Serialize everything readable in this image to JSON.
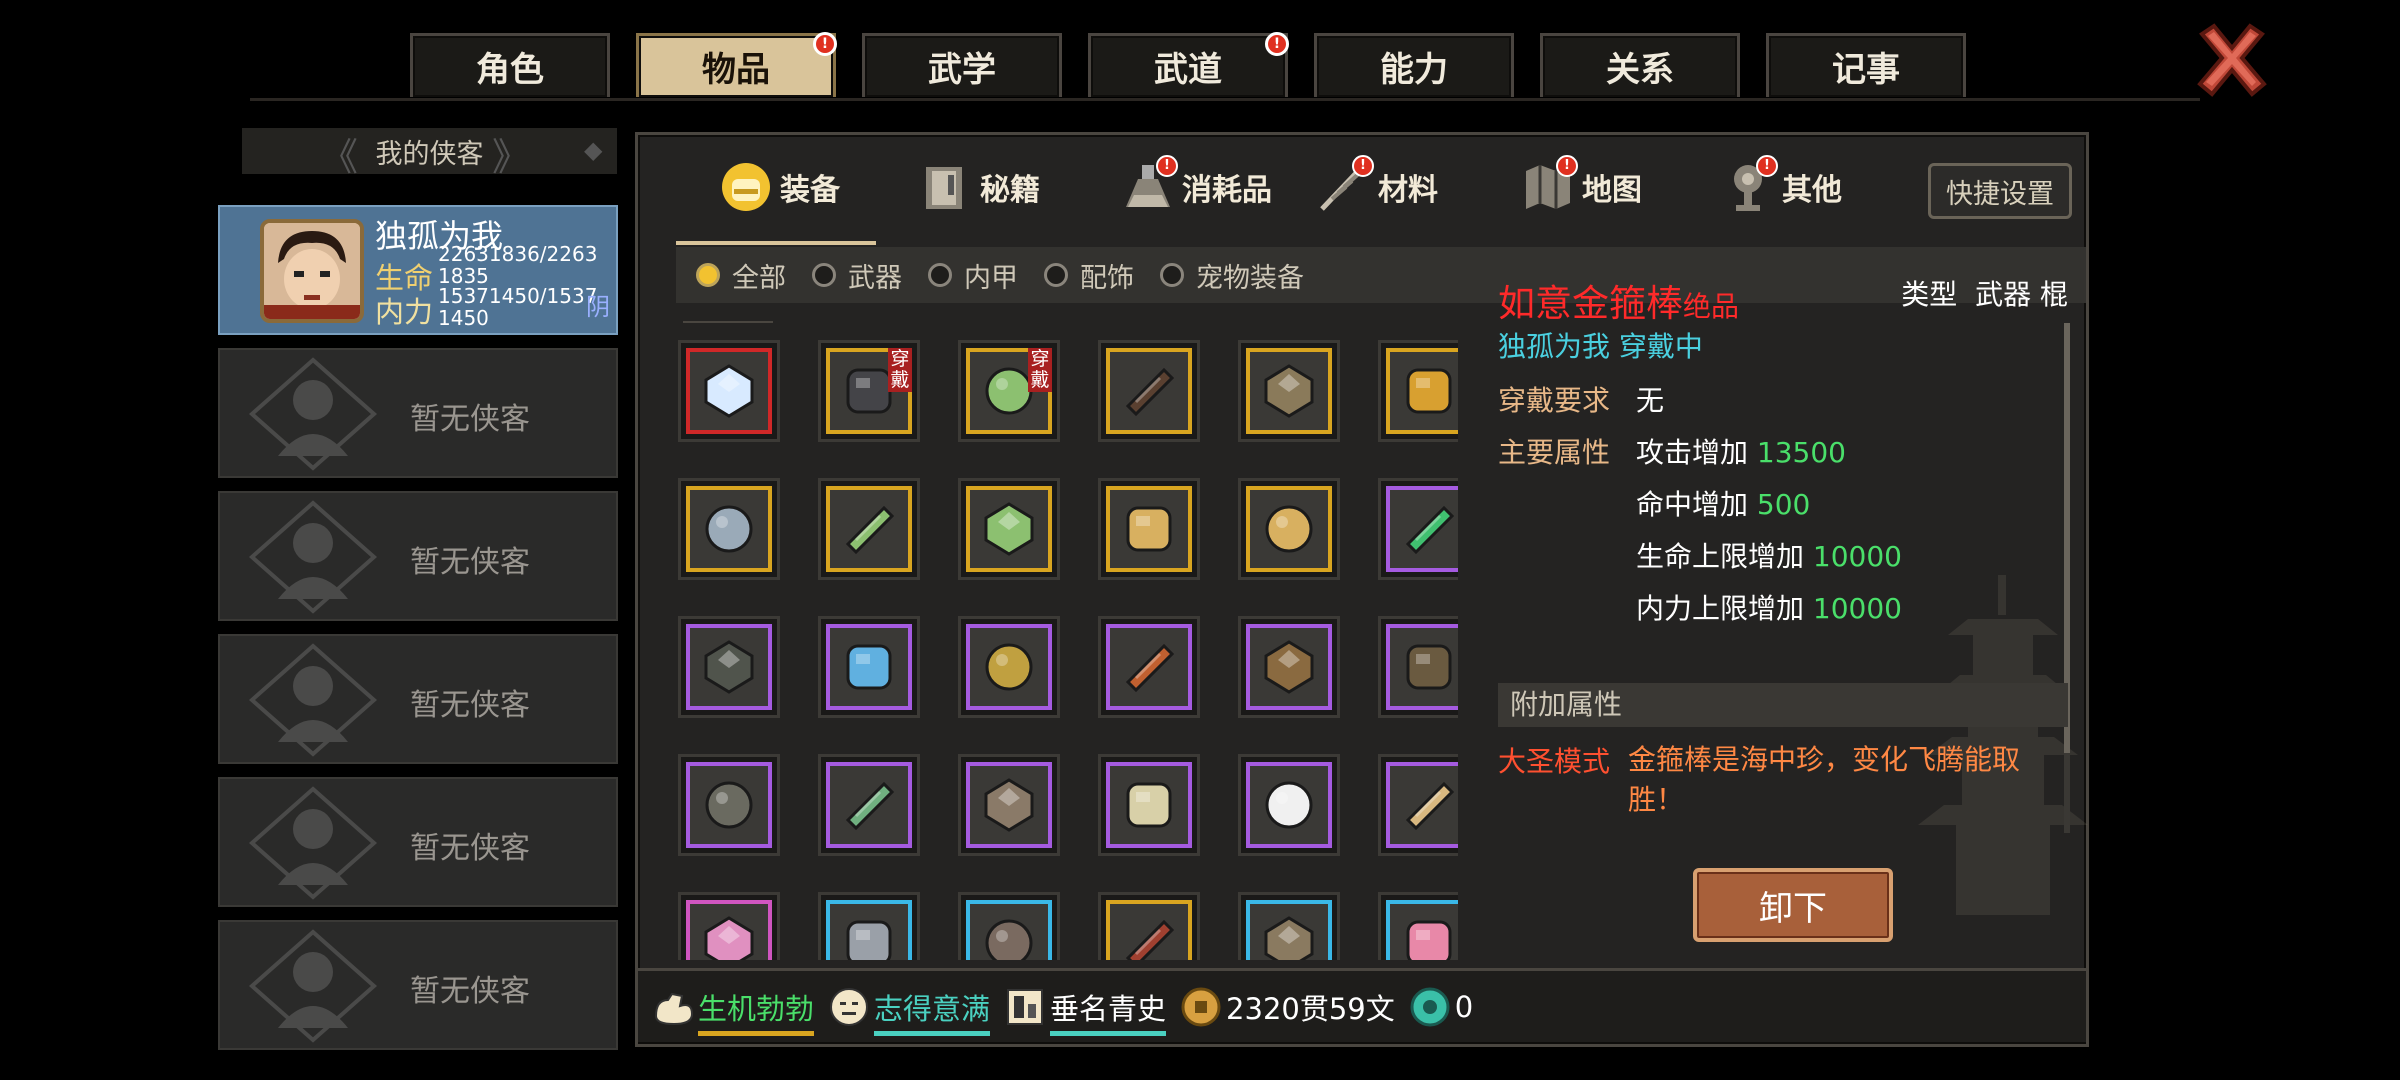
{
  "top_tabs": [
    {
      "label": "角色",
      "active": false,
      "badge": false
    },
    {
      "label": "物品",
      "active": true,
      "badge": true
    },
    {
      "label": "武学",
      "active": false,
      "badge": false
    },
    {
      "label": "武道",
      "active": false,
      "badge": true
    },
    {
      "label": "能力",
      "active": false,
      "badge": false
    },
    {
      "label": "关系",
      "active": false,
      "badge": false
    },
    {
      "label": "记事",
      "active": false,
      "badge": false
    }
  ],
  "badge_glyph": "!",
  "sidebar": {
    "title": "我的侠客",
    "hero": {
      "name": "独孤为我",
      "hp_label": "生命",
      "hp_value": "22631836/22631835",
      "mp_label": "内力",
      "mp_value": "15371450/15371450",
      "tag": "阴"
    },
    "empty_label": "暂无侠客",
    "empty_count": 5
  },
  "categories": [
    {
      "label": "装备",
      "icon": "helmet-icon",
      "badge": false,
      "active": true
    },
    {
      "label": "秘籍",
      "icon": "book-icon",
      "badge": false,
      "active": false
    },
    {
      "label": "消耗品",
      "icon": "flask-icon",
      "badge": true,
      "active": false
    },
    {
      "label": "材料",
      "icon": "herb-icon",
      "badge": true,
      "active": false
    },
    {
      "label": "地图",
      "icon": "map-icon",
      "badge": true,
      "active": false
    },
    {
      "label": "其他",
      "icon": "lamp-icon",
      "badge": true,
      "active": false
    }
  ],
  "quick_settings": "快捷设置",
  "filters": [
    {
      "label": "全部",
      "selected": true
    },
    {
      "label": "武器",
      "selected": false
    },
    {
      "label": "内甲",
      "selected": false
    },
    {
      "label": "配饰",
      "selected": false
    },
    {
      "label": "宠物装备",
      "selected": false
    }
  ],
  "worn_tag": "穿戴",
  "items": [
    {
      "name": "crystal-ball-icon",
      "rarity": "red",
      "color": "#d8eaff",
      "worn": false
    },
    {
      "name": "dark-armor-icon",
      "rarity": "gold",
      "color": "#444448",
      "worn": true
    },
    {
      "name": "jade-vest-icon",
      "rarity": "gold",
      "color": "#8cc070",
      "worn": true
    },
    {
      "name": "prayer-beads-icon",
      "rarity": "gold",
      "color": "#5a4030",
      "worn": false
    },
    {
      "name": "bamboo-scroll-icon",
      "rarity": "gold",
      "color": "#8a7a5a",
      "worn": false
    },
    {
      "name": "bronze-mask-icon",
      "rarity": "gold",
      "color": "#d8a030",
      "worn": false
    },
    {
      "name": "silver-bracer-icon",
      "rarity": "gold",
      "color": "#9aaab8",
      "worn": false
    },
    {
      "name": "jade-vest-icon",
      "rarity": "gold",
      "color": "#8cc070",
      "worn": false
    },
    {
      "name": "jade-vest-icon",
      "rarity": "gold",
      "color": "#8cc070",
      "worn": false
    },
    {
      "name": "gold-card-icon",
      "rarity": "gold",
      "color": "#d8b060",
      "worn": false
    },
    {
      "name": "gold-card-icon",
      "rarity": "gold",
      "color": "#d8b060",
      "worn": false
    },
    {
      "name": "jade-blade-icon",
      "rarity": "purple",
      "color": "#40c070",
      "worn": false
    },
    {
      "name": "iron-plate-icon",
      "rarity": "purple",
      "color": "#50544c",
      "worn": false
    },
    {
      "name": "blue-ribbon-icon",
      "rarity": "purple",
      "color": "#60b0e0",
      "worn": false
    },
    {
      "name": "gold-beast-icon",
      "rarity": "purple",
      "color": "#c0a040",
      "worn": false
    },
    {
      "name": "red-token-icon",
      "rarity": "purple",
      "color": "#c06030",
      "worn": false
    },
    {
      "name": "bronze-seal-icon",
      "rarity": "purple",
      "color": "#8a6a40",
      "worn": false
    },
    {
      "name": "clay-jar-icon",
      "rarity": "purple",
      "color": "#6a5a40",
      "worn": false
    },
    {
      "name": "stone-bar-icon",
      "rarity": "purple",
      "color": "#6a6a60",
      "worn": false
    },
    {
      "name": "jade-stone-icon",
      "rarity": "purple",
      "color": "#70b080",
      "worn": false
    },
    {
      "name": "ore-pendant-icon",
      "rarity": "purple",
      "color": "#8a7a68",
      "worn": false
    },
    {
      "name": "stone-seal-icon",
      "rarity": "purple",
      "color": "#d8d0a8",
      "worn": false
    },
    {
      "name": "white-feather-icon",
      "rarity": "purple",
      "color": "#f0f0f0",
      "worn": false
    },
    {
      "name": "beast-tooth-icon",
      "rarity": "purple",
      "color": "#d8b880",
      "worn": false
    },
    {
      "name": "pink-pouch-icon",
      "rarity": "pink",
      "color": "#e090c0",
      "worn": false
    },
    {
      "name": "steel-gauntlet-icon",
      "rarity": "blue",
      "color": "#9aa0a8",
      "worn": false
    },
    {
      "name": "sword-icon",
      "rarity": "blue",
      "color": "#7a6a60",
      "worn": false
    },
    {
      "name": "red-robe-icon",
      "rarity": "gold",
      "color": "#a04030",
      "worn": false
    },
    {
      "name": "wrapped-bundle-icon",
      "rarity": "blue",
      "color": "#8a7a60",
      "worn": false
    },
    {
      "name": "pink-flower-icon",
      "rarity": "blue",
      "color": "#e888a8",
      "worn": false
    }
  ],
  "detail": {
    "name": "如意金箍棒",
    "grade": "绝品",
    "type_label": "类型",
    "type_value": "武器 棍",
    "owner_line": "独孤为我 穿戴中",
    "req_label": "穿戴要求",
    "req_value": "无",
    "main_label": "主要属性",
    "attributes": [
      {
        "label": "攻击增加",
        "value": "13500"
      },
      {
        "label": "命中增加",
        "value": "500"
      },
      {
        "label": "生命上限增加",
        "value": "10000"
      },
      {
        "label": "内力上限增加",
        "value": "10000"
      }
    ],
    "extra_header": "附加属性",
    "extra_name": "大圣模式",
    "extra_desc": "金箍棒是海中珍，变化飞腾能取胜！",
    "unequip": "卸下"
  },
  "status": [
    {
      "icon": "muscle-icon",
      "text": "生机勃勃",
      "color": "#4adf6a",
      "bar": "#d9a520"
    },
    {
      "icon": "smile-icon",
      "text": "志得意满",
      "color": "#4ad0c0",
      "bar": "#4ad0c0"
    },
    {
      "icon": "scroll-icon",
      "text": "垂名青史",
      "color": "#ffffff",
      "bar": "#4ad0c0"
    },
    {
      "icon": "coin-icon",
      "text": "2320贯59文",
      "color": "#ffffff",
      "bar": ""
    },
    {
      "icon": "jade-coin-icon",
      "text": "0",
      "color": "#ffffff",
      "bar": ""
    }
  ],
  "colors": {
    "accent_gold": "#d9c49a",
    "badge_red": "#e03020",
    "stat_green": "#4adf6a"
  }
}
